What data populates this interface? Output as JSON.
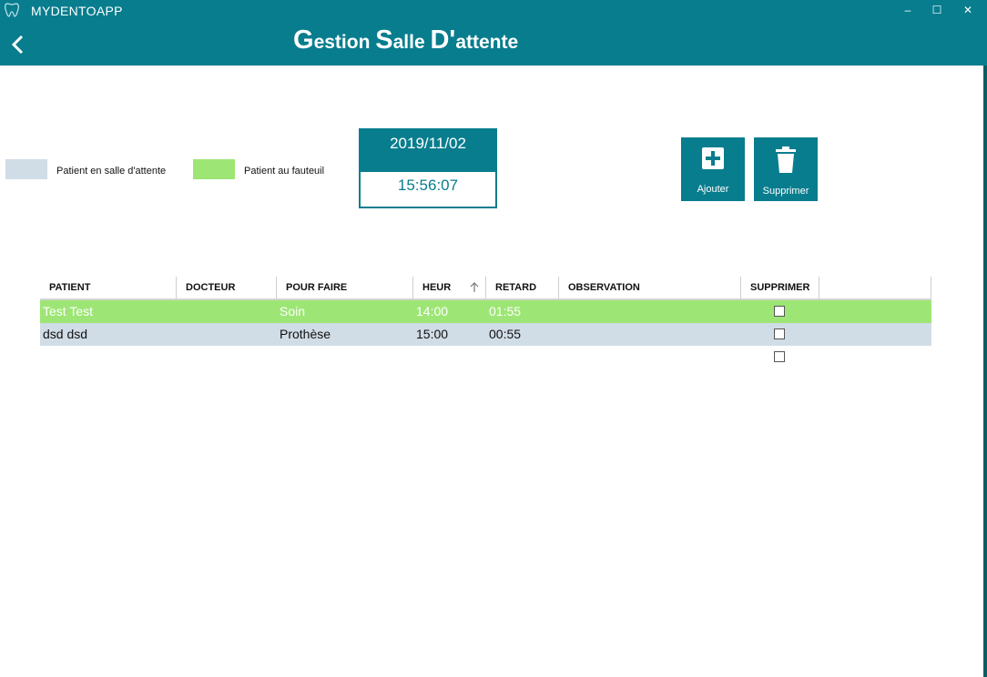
{
  "app": {
    "name": "MYDENTOAPP"
  },
  "window": {
    "minimize": "–",
    "maximize": "☐",
    "close": "✕"
  },
  "header": {
    "title_parts": [
      "G",
      "estion ",
      "S",
      "alle ",
      "D'",
      "attente"
    ]
  },
  "legend": [
    {
      "label": "Patient en salle d'attente",
      "color": "#d0dce6"
    },
    {
      "label": "Patient au fauteuil",
      "color": "#9de675"
    }
  ],
  "clock": {
    "date": "2019/11/02",
    "time": "15:56:07"
  },
  "actions": {
    "add_label": "Ajouter",
    "delete_label": "Supprimer"
  },
  "table": {
    "columns": [
      "PATIENT",
      "DOCTEUR",
      "POUR FAIRE",
      "HEUR",
      "RETARD",
      "OBSERVATION",
      "SUPPRIMER"
    ],
    "sort_icon": "arrow-up-icon",
    "rows": [
      {
        "patient": "Test  Test",
        "docteur": "",
        "pour_faire": "Soin",
        "heur": "14:00",
        "retard": "01:55",
        "observation": "",
        "supprimer": false,
        "status": "fauteuil"
      },
      {
        "patient": "dsd dsd",
        "docteur": "",
        "pour_faire": "Prothèse",
        "heur": "15:00",
        "retard": "00:55",
        "observation": "",
        "supprimer": false,
        "status": "attente"
      },
      {
        "patient": "",
        "docteur": "",
        "pour_faire": "",
        "heur": "",
        "retard": "",
        "observation": "",
        "supprimer": false,
        "status": "none"
      }
    ]
  },
  "colors": {
    "primary": "#087d8e",
    "waiting": "#d0dce6",
    "in_chair": "#9de675"
  }
}
